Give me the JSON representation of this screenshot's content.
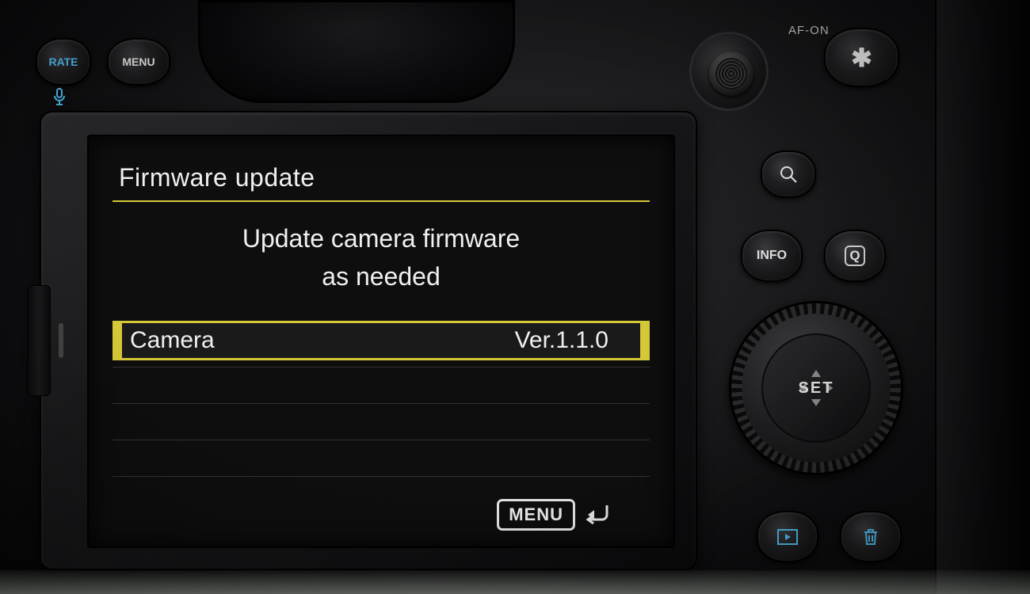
{
  "top_buttons": {
    "rate_label": "RATE",
    "menu_label": "MENU",
    "afon_label": "AF-ON",
    "star_label": "✱"
  },
  "right_buttons": {
    "info_label": "INFO",
    "q_label": "Q",
    "set_label": "SET"
  },
  "lcd": {
    "title": "Firmware update",
    "subtitle_line1": "Update camera firmware",
    "subtitle_line2": "as needed",
    "row_label": "Camera",
    "row_value": "Ver.1.1.0",
    "menu_badge": "MENU"
  },
  "icons": {
    "mic": "mic-icon",
    "magnify": "magnify-icon",
    "playback": "playback-icon",
    "trash": "trash-icon",
    "back_arrow": "back-arrow-icon"
  },
  "colors": {
    "accent_yellow": "#d4c838",
    "accent_blue": "#4fb8e8",
    "text_light": "#f0f0f0"
  }
}
